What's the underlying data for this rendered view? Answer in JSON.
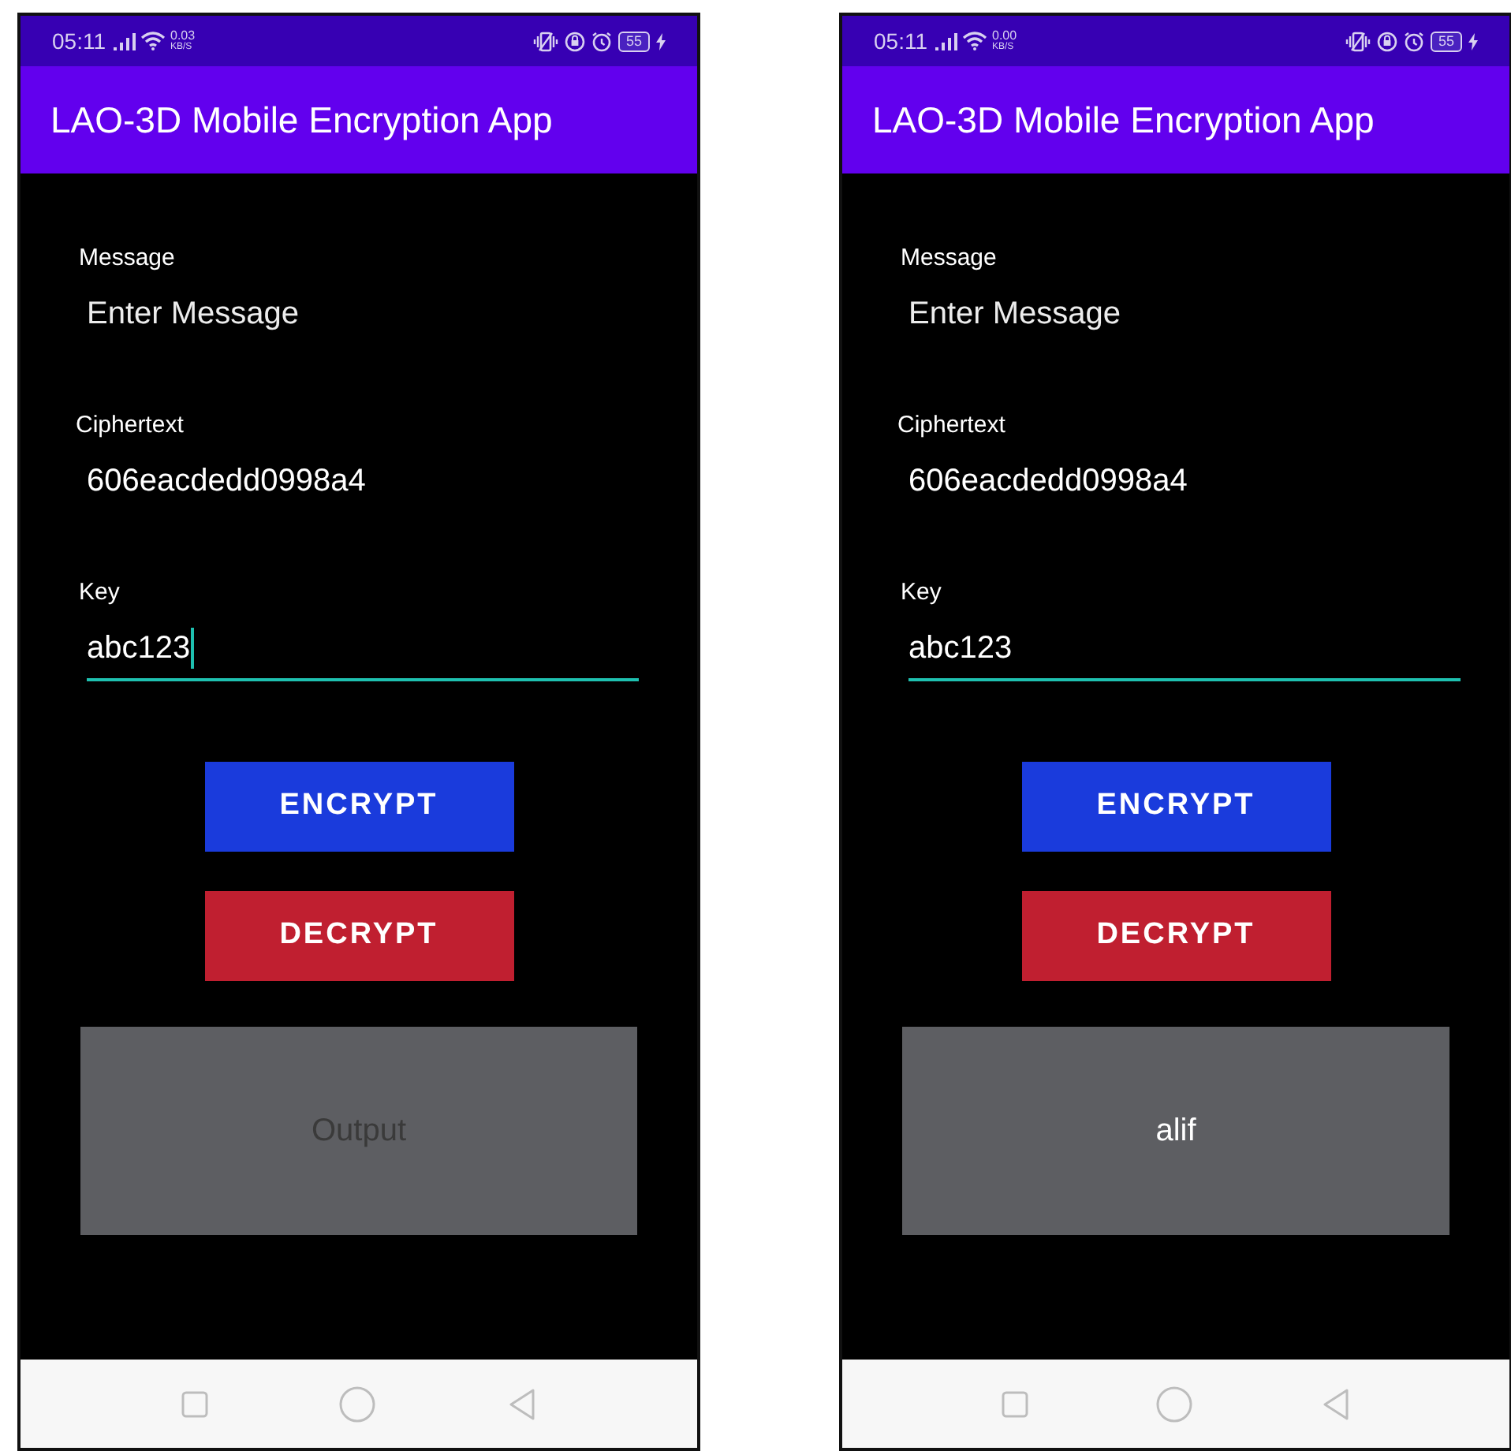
{
  "screens": [
    {
      "status_bar": {
        "time": "05:11",
        "net_speed": "0.03",
        "net_unit": "KB/S",
        "battery": "55"
      },
      "title": "LAO-3D Mobile Encryption App",
      "message": {
        "label": "Message",
        "placeholder": "Enter Message"
      },
      "ciphertext": {
        "label": "Ciphertext",
        "value": "606eacdedd0998a4"
      },
      "key": {
        "label": "Key",
        "value": "abc123",
        "focused": true
      },
      "buttons": [
        {
          "label": "ENCRYPT",
          "kind": "encrypt"
        },
        {
          "label": "DECRYPT",
          "kind": "decrypt"
        }
      ],
      "output": {
        "text": "Output",
        "is_placeholder": true
      }
    },
    {
      "status_bar": {
        "time": "05:11",
        "net_speed": "0.00",
        "net_unit": "KB/S",
        "battery": "55"
      },
      "title": "LAO-3D Mobile Encryption App",
      "message": {
        "label": "Message",
        "placeholder": "Enter Message"
      },
      "ciphertext": {
        "label": "Ciphertext",
        "value": "606eacdedd0998a4"
      },
      "key": {
        "label": "Key",
        "value": "abc123",
        "focused": false
      },
      "buttons": [
        {
          "label": "ENCRYPT",
          "kind": "encrypt"
        },
        {
          "label": "DECRYPT",
          "kind": "decrypt"
        }
      ],
      "output": {
        "text": "alif",
        "is_placeholder": false
      }
    }
  ]
}
